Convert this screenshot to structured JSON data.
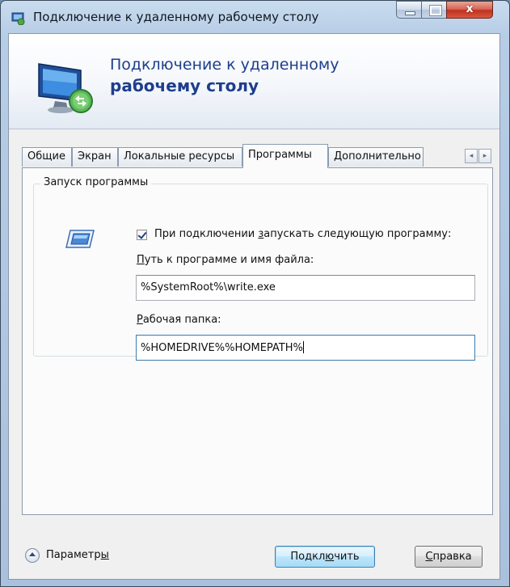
{
  "window": {
    "title": "Подключение к удаленному рабочему столу",
    "close_glyph": "x",
    "accent_color": "#1e3e8c"
  },
  "banner": {
    "line1": "Подключение к удаленному",
    "line2": "рабочему столу",
    "icon": "remote-desktop-monitor-icon"
  },
  "tabs": [
    {
      "label": "Общие",
      "active": false
    },
    {
      "label": "Экран",
      "active": false
    },
    {
      "label": "Локальные ресурсы",
      "active": false
    },
    {
      "label": "Программы",
      "active": true
    },
    {
      "label": "Дополнительно",
      "active": false
    }
  ],
  "tab_scroll": {
    "left": "◂",
    "right": "▸"
  },
  "group": {
    "legend": "Запуск программы",
    "icon": "program-window-icon",
    "checkbox": {
      "checked": true,
      "label_before": "При подключении ",
      "label_key": "з",
      "label_after": "апускать следующую программу:"
    },
    "path_label": {
      "key": "П",
      "rest": "уть к программе и имя файла:"
    },
    "path_value": "%SystemRoot%\\write.exe",
    "folder_label": {
      "key": "Р",
      "rest": "абочая папка:"
    },
    "folder_value": "%HOMEDRIVE%%HOMEPATH%"
  },
  "footer": {
    "options_label_before": "Параметр",
    "options_label_key": "ы",
    "connect_before": "Подкл",
    "connect_key": "ю",
    "connect_after": "чить",
    "help_key": "С",
    "help_rest": "правка"
  }
}
